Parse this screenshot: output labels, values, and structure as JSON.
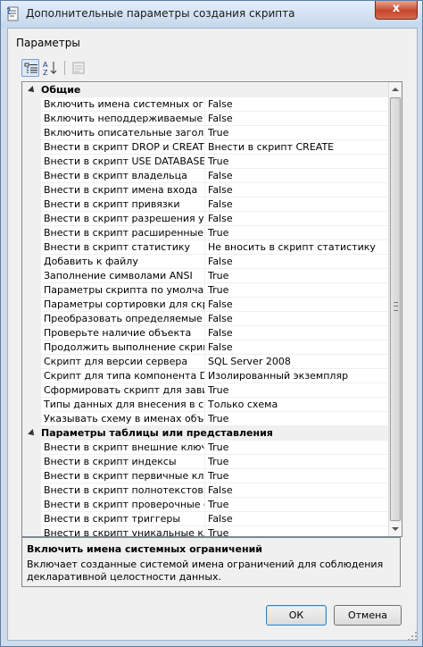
{
  "window": {
    "title": "Дополнительные параметры создания скрипта",
    "close_symbol": "x"
  },
  "section_label": "Параметры",
  "categories": {
    "general": "Общие",
    "table_view": "Параметры таблицы или представления"
  },
  "properties_general": [
    {
      "name": "Включить имена системных ограни",
      "value": "False"
    },
    {
      "name": "Включить неподдерживаемые инстр",
      "value": "False"
    },
    {
      "name": "Включить описательные заголовки",
      "value": "True"
    },
    {
      "name": "Внести в скрипт DROP и CREATE",
      "value": "Внести в скрипт CREATE"
    },
    {
      "name": "Внести в скрипт USE DATABASE",
      "value": "True"
    },
    {
      "name": "Внести в скрипт владельца",
      "value": "False"
    },
    {
      "name": "Внести в скрипт имена входа",
      "value": "False"
    },
    {
      "name": "Внести в скрипт привязки",
      "value": "False"
    },
    {
      "name": "Внести в скрипт разрешения уровня",
      "value": "False"
    },
    {
      "name": "Внести в скрипт расширенные свой",
      "value": "True"
    },
    {
      "name": "Внести в скрипт статистику",
      "value": "Не вносить в скрипт статистику"
    },
    {
      "name": "Добавить к файлу",
      "value": "False"
    },
    {
      "name": "Заполнение символами ANSI",
      "value": "True"
    },
    {
      "name": "Параметры скрипта по умолчанию",
      "value": "True"
    },
    {
      "name": "Параметры сортировки для скрипт",
      "value": "False"
    },
    {
      "name": "Преобразовать определяемые поль",
      "value": "False"
    },
    {
      "name": "Проверьте наличие объекта",
      "value": "False"
    },
    {
      "name": "Продолжить выполнение скрипта п",
      "value": "False"
    },
    {
      "name": "Скрипт для версии сервера",
      "value": "SQL Server 2008"
    },
    {
      "name": "Скрипт для типа компонента Datab",
      "value": "Изолированный экземпляр"
    },
    {
      "name": "Сформировать скрипт для зависим",
      "value": "True"
    },
    {
      "name": "Типы данных для внесения в скрипт",
      "value": "Только схема"
    },
    {
      "name": "Указывать схему в именах объектс",
      "value": "True"
    }
  ],
  "properties_table": [
    {
      "name": "Внести в скрипт внешние ключи",
      "value": "True"
    },
    {
      "name": "Внести в скрипт индексы",
      "value": "True"
    },
    {
      "name": "Внести в скрипт первичные ключи",
      "value": "True"
    },
    {
      "name": "Внести в скрипт полнотекстовые и",
      "value": "False"
    },
    {
      "name": "Внести в скрипт проверочные огра",
      "value": "True"
    },
    {
      "name": "Внести в скрипт триггеры",
      "value": "False"
    },
    {
      "name": "Внести в скрипт уникальные ключи",
      "value": "True"
    }
  ],
  "description": {
    "title": "Включить имена системных ограничений",
    "text": "Включает созданные системой имена ограничений для соблюдения декларативной целостности данных."
  },
  "buttons": {
    "ok": "ОК",
    "cancel": "Отмена"
  }
}
